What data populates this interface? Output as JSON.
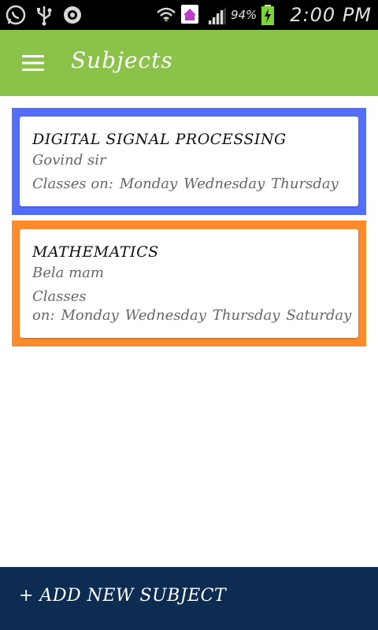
{
  "status_bar": {
    "battery_percent": "94%",
    "time": "2:00 PM",
    "icons": [
      "whatsapp-icon",
      "usb-icon",
      "sync-icon",
      "wifi-icon",
      "home-notification-icon",
      "signal-icon",
      "battery-charging-icon"
    ]
  },
  "app_bar": {
    "title": "Subjects",
    "menu_icon": "hamburger-menu-icon",
    "color": "#8bc34a"
  },
  "subjects": [
    {
      "name": "DIGITAL SIGNAL PROCESSING",
      "teacher": "Govind sir",
      "classes_prefix": "Classes on:",
      "days": [
        "Monday",
        "Wednesday",
        "Thursday"
      ],
      "color": "#536dfe"
    },
    {
      "name": "MATHEMATICS",
      "teacher": "Bela mam",
      "classes_prefix": "Classes on:",
      "days": [
        "Monday",
        "Wednesday",
        "Thursday",
        "Saturday"
      ],
      "color": "#ff8a2b"
    }
  ],
  "add_button": {
    "label": "+ ADD NEW SUBJECT",
    "color": "#0d2c52"
  }
}
